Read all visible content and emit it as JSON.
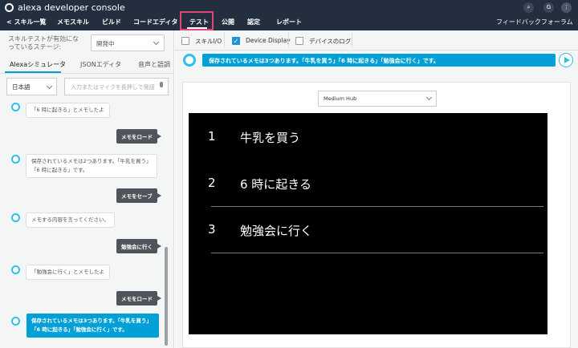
{
  "header": {
    "app_title": "alexa developer console",
    "icons": [
      "search-icon",
      "avatar-icon",
      "more-vertical-icon"
    ],
    "avatar_initial": "G"
  },
  "nav": {
    "back": "< スキル一覧",
    "items": [
      "メモスキル",
      "ビルド",
      "コードエディタ",
      "テスト",
      "公開",
      "認定",
      "レポート"
    ],
    "active": "テスト",
    "feedback": "フィードバックフォーラム",
    "accent_color": "#e0457b"
  },
  "left": {
    "stage_label": "スキルテストが有効になっているステージ:",
    "stage_value": "開発中",
    "tabs": [
      "Alexaシミュレータ",
      "JSONエディタ",
      "音声と語調"
    ],
    "language": "日本語",
    "utterance_placeholder": "入力またはマイクを長押しで発話",
    "chat": [
      {
        "from": "alexa",
        "text": "「6 時に起きる」とメモしたよ"
      },
      {
        "from": "user",
        "text": "メモをロード"
      },
      {
        "from": "alexa",
        "text": "保存されているメモは2つあります。「牛乳を買う」「6 時に起きる」です。"
      },
      {
        "from": "user",
        "text": "メモをセーブ"
      },
      {
        "from": "alexa",
        "text": "メモする内容を言ってください。"
      },
      {
        "from": "user",
        "text": "勉強会に行く"
      },
      {
        "from": "alexa",
        "text": "「勉強会に行く」とメモしたよ"
      },
      {
        "from": "user",
        "text": "メモをロード"
      },
      {
        "from": "alexa-latest",
        "text": "保存されているメモは3つあります。「牛乳を買う」「6 時に起きる」「勉強会に行く」です。"
      }
    ]
  },
  "right": {
    "options": [
      {
        "label": "スキルI/O",
        "checked": false
      },
      {
        "label": "Device Display",
        "checked": true
      },
      {
        "label": "デバイスのログ",
        "checked": false
      }
    ],
    "response": "保存されているメモは3つあります。「牛乳を買う」「6 時に起きる」「勉強会に行く」です。",
    "device": "Medium Hub",
    "todos": [
      {
        "num": "1",
        "text": "牛乳を買う"
      },
      {
        "num": "2",
        "text": "6 時に起きる"
      },
      {
        "num": "3",
        "text": "勉強会に行く"
      }
    ]
  }
}
